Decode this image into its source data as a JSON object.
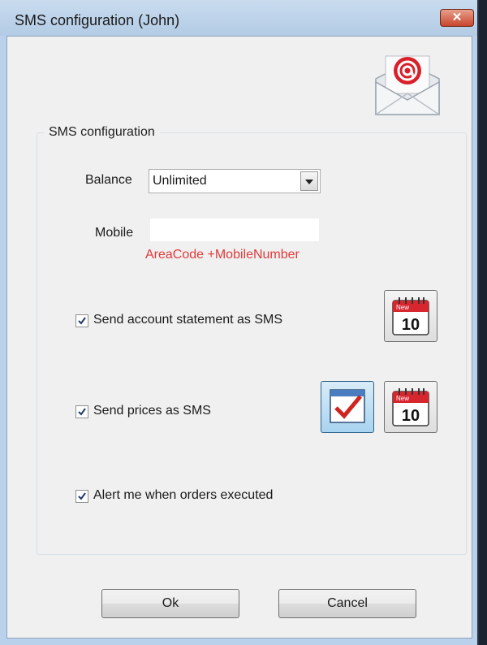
{
  "window": {
    "title": "SMS configuration (John)",
    "close_symbol": "✕"
  },
  "group": {
    "legend": "SMS configuration"
  },
  "balance": {
    "label": "Balance",
    "selected": "Unlimited"
  },
  "mobile": {
    "label": "Mobile",
    "value": "",
    "hint": "AreaCode +MobileNumber",
    "hint_color": "#e03a3a"
  },
  "options": [
    {
      "label": "Send account statement as SMS",
      "checked": true
    },
    {
      "label": "Send prices as SMS",
      "checked": true
    },
    {
      "label": "Alert me when orders executed",
      "checked": true
    }
  ],
  "calendar_icon_text": "10",
  "calendar_header_text": "New",
  "buttons": {
    "ok": "Ok",
    "cancel": "Cancel"
  },
  "icons": [
    "email-at-icon",
    "calendar-icon",
    "checklist-icon",
    "close-icon",
    "dropdown-arrow-icon",
    "checkmark-icon"
  ]
}
